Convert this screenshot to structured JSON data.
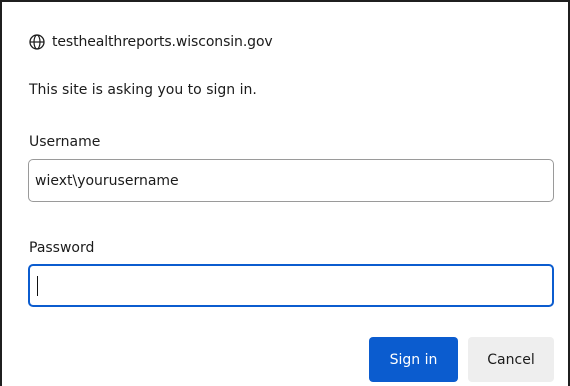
{
  "dialog": {
    "site": "testhealthreports.wisconsin.gov",
    "site_icon": "globe-icon",
    "prompt": "This site is asking you to sign in.",
    "username_label": "Username",
    "username_value": "wiext\\yourusername",
    "password_label": "Password",
    "password_value": "",
    "signin_label": "Sign in",
    "cancel_label": "Cancel"
  },
  "colors": {
    "accent": "#0b5ccf",
    "cancel_bg": "#eeeeee",
    "text": "#1b1b1b"
  }
}
